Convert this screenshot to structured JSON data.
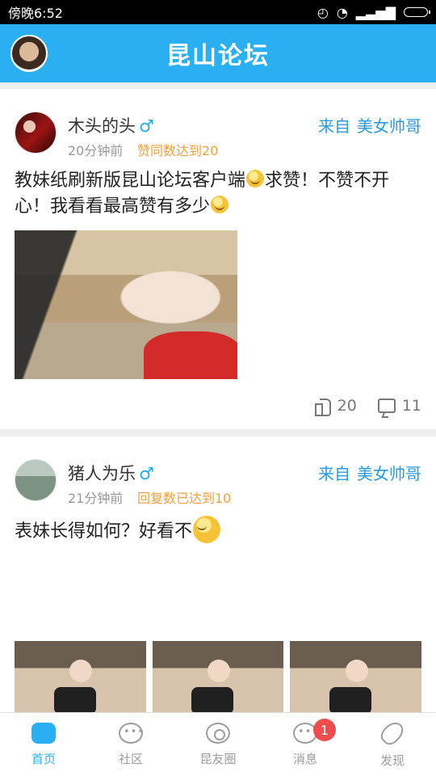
{
  "status": {
    "time": "傍晚6:52"
  },
  "header": {
    "title": "昆山论坛"
  },
  "posts": [
    {
      "author": "木头的头",
      "gender": "♂",
      "time": "20分钟前",
      "badge": "赞同数达到20",
      "from_prefix": "来自",
      "from_name": "美女帅哥",
      "text_before_emoji1": "教妹纸刷新版昆山论坛客户端",
      "text_between_emojis": "求赞！不赞不开心！我看看最高赞有多少",
      "likes": "20",
      "comments": "11"
    },
    {
      "author": "猪人为乐",
      "gender": "♂",
      "time": "21分钟前",
      "badge": "回复数已达到10",
      "from_prefix": "来自",
      "from_name": "美女帅哥",
      "text": "表妹长得如何？好看不"
    }
  ],
  "tabs": [
    {
      "label": "首页",
      "icon": "chat-bubbles-icon",
      "active": true
    },
    {
      "label": "社区",
      "icon": "community-icon",
      "active": false
    },
    {
      "label": "昆友圈",
      "icon": "eye-circle-icon",
      "active": false
    },
    {
      "label": "消息",
      "icon": "message-icon",
      "active": false,
      "badge": "1"
    },
    {
      "label": "发现",
      "icon": "rocket-icon",
      "active": false
    }
  ]
}
